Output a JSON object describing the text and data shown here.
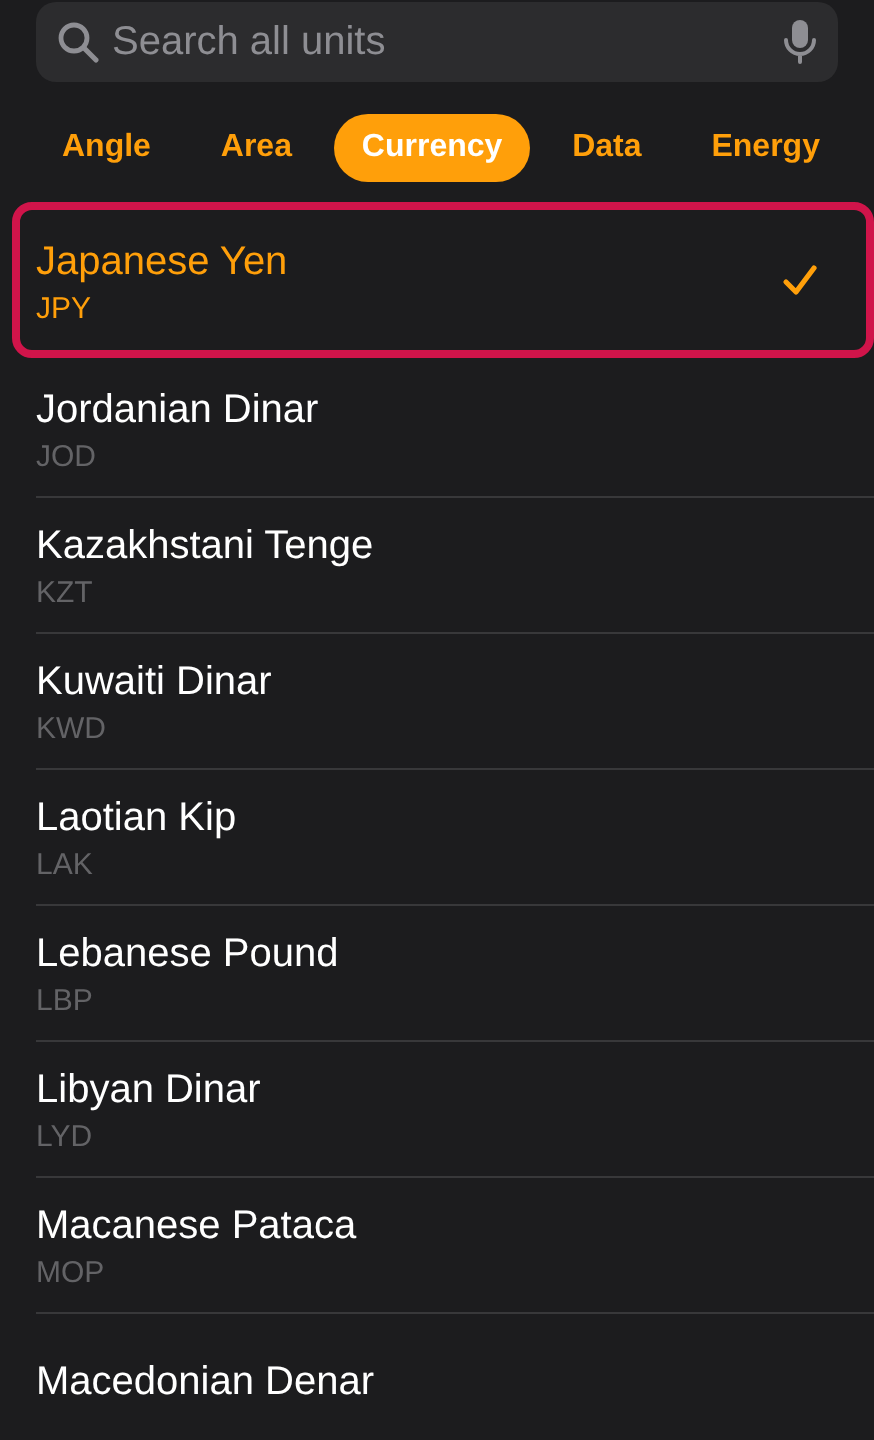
{
  "search": {
    "placeholder": "Search all units"
  },
  "tabs": [
    {
      "label": "Angle",
      "selected": false
    },
    {
      "label": "Area",
      "selected": false
    },
    {
      "label": "Currency",
      "selected": true
    },
    {
      "label": "Data",
      "selected": false
    },
    {
      "label": "Energy",
      "selected": false
    }
  ],
  "units": [
    {
      "name": "Japanese Yen",
      "code": "JPY",
      "selected": true,
      "outlined": true
    },
    {
      "name": "Jordanian Dinar",
      "code": "JOD",
      "selected": false,
      "outlined": false
    },
    {
      "name": "Kazakhstani Tenge",
      "code": "KZT",
      "selected": false,
      "outlined": false
    },
    {
      "name": "Kuwaiti Dinar",
      "code": "KWD",
      "selected": false,
      "outlined": false
    },
    {
      "name": "Laotian Kip",
      "code": "LAK",
      "selected": false,
      "outlined": false
    },
    {
      "name": "Lebanese Pound",
      "code": "LBP",
      "selected": false,
      "outlined": false
    },
    {
      "name": "Libyan Dinar",
      "code": "LYD",
      "selected": false,
      "outlined": false
    },
    {
      "name": "Macanese Pataca",
      "code": "MOP",
      "selected": false,
      "outlined": false
    },
    {
      "name": "Macedonian Denar",
      "selected": false,
      "outlined": false
    }
  ]
}
